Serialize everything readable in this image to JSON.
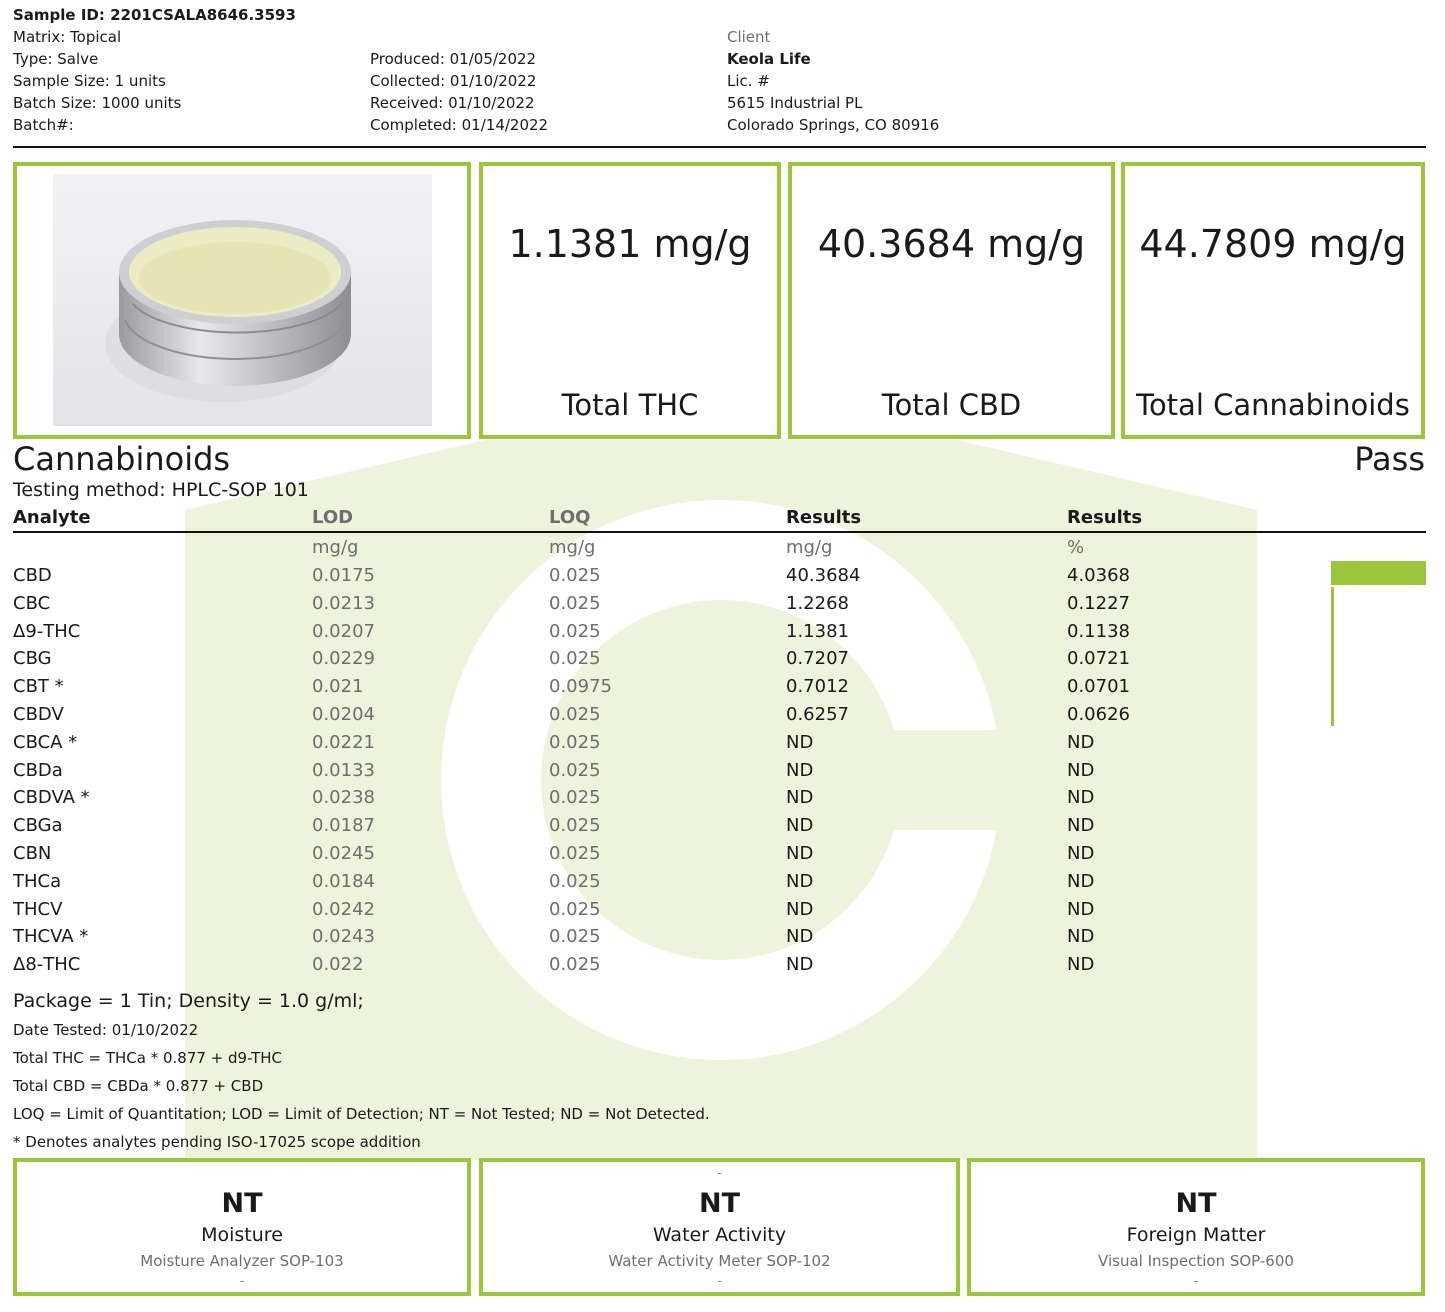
{
  "sample": {
    "id_line": "Sample ID: 2201CSALA8646.3593",
    "matrix": "Matrix: Topical",
    "type": "Type: Salve",
    "sample_size": "Sample Size: 1 units",
    "batch_size": "Batch Size: 1000 units",
    "batch_no": "Batch#:"
  },
  "dates": {
    "produced": "Produced: 01/05/2022",
    "collected": "Collected: 01/10/2022",
    "received": "Received: 01/10/2022",
    "completed": "Completed: 01/14/2022"
  },
  "client": {
    "heading": "Client",
    "name": "Keola Life",
    "lic": "Lic. #",
    "address1": "5615 Industrial PL",
    "address2": "Colorado Springs, CO 80916"
  },
  "summary": [
    {
      "value": "1.1381 mg/g",
      "label": "Total THC"
    },
    {
      "value": "40.3684 mg/g",
      "label": "Total CBD"
    },
    {
      "value": "44.7809 mg/g",
      "label": "Total Cannabinoids"
    }
  ],
  "cannabinoids": {
    "title": "Cannabinoids",
    "status": "Pass",
    "method": "Testing method: HPLC-SOP 101",
    "headers": [
      "Analyte",
      "LOD",
      "LOQ",
      "Results",
      "Results"
    ],
    "units": [
      "mg/g",
      "mg/g",
      "mg/g",
      "%"
    ],
    "rows": [
      {
        "analyte": "CBD",
        "lod": "0.0175",
        "loq": "0.025",
        "mg": "40.3684",
        "pct": "4.0368",
        "bar_pct": 4.0368
      },
      {
        "analyte": "CBC",
        "lod": "0.0213",
        "loq": "0.025",
        "mg": "1.2268",
        "pct": "0.1227",
        "bar_pct": 0.1227
      },
      {
        "analyte": "Δ9-THC",
        "lod": "0.0207",
        "loq": "0.025",
        "mg": "1.1381",
        "pct": "0.1138",
        "bar_pct": 0.1138
      },
      {
        "analyte": "CBG",
        "lod": "0.0229",
        "loq": "0.025",
        "mg": "0.7207",
        "pct": "0.0721",
        "bar_pct": 0.0721
      },
      {
        "analyte": "CBT *",
        "lod": "0.021",
        "loq": "0.0975",
        "mg": "0.7012",
        "pct": "0.0701",
        "bar_pct": 0.0701
      },
      {
        "analyte": "CBDV",
        "lod": "0.0204",
        "loq": "0.025",
        "mg": "0.6257",
        "pct": "0.0626",
        "bar_pct": 0.0626
      },
      {
        "analyte": "CBCA *",
        "lod": "0.0221",
        "loq": "0.025",
        "mg": "ND",
        "pct": "ND",
        "bar_pct": 0
      },
      {
        "analyte": "CBDa",
        "lod": "0.0133",
        "loq": "0.025",
        "mg": "ND",
        "pct": "ND",
        "bar_pct": 0
      },
      {
        "analyte": "CBDVA *",
        "lod": "0.0238",
        "loq": "0.025",
        "mg": "ND",
        "pct": "ND",
        "bar_pct": 0
      },
      {
        "analyte": "CBGa",
        "lod": "0.0187",
        "loq": "0.025",
        "mg": "ND",
        "pct": "ND",
        "bar_pct": 0
      },
      {
        "analyte": "CBN",
        "lod": "0.0245",
        "loq": "0.025",
        "mg": "ND",
        "pct": "ND",
        "bar_pct": 0
      },
      {
        "analyte": "THCa",
        "lod": "0.0184",
        "loq": "0.025",
        "mg": "ND",
        "pct": "ND",
        "bar_pct": 0
      },
      {
        "analyte": "THCV",
        "lod": "0.0242",
        "loq": "0.025",
        "mg": "ND",
        "pct": "ND",
        "bar_pct": 0
      },
      {
        "analyte": "THCVA *",
        "lod": "0.0243",
        "loq": "0.025",
        "mg": "ND",
        "pct": "ND",
        "bar_pct": 0
      },
      {
        "analyte": "Δ8-THC",
        "lod": "0.022",
        "loq": "0.025",
        "mg": "ND",
        "pct": "ND",
        "bar_pct": 0
      }
    ]
  },
  "notes": {
    "package": "Package = 1 Tin; Density = 1.0 g/ml;",
    "date_tested": "Date Tested: 01/10/2022",
    "total_thc": "Total THC = THCa * 0.877 + d9-THC",
    "total_cbd": "Total CBD = CBDa * 0.877 + CBD",
    "legend": "LOQ = Limit of Quantitation; LOD = Limit of Detection; NT = Not Tested; ND = Not Detected.",
    "pending": "* Denotes analytes pending ISO-17025 scope addition"
  },
  "safety": [
    {
      "value": "NT",
      "label": "Moisture",
      "method": "Moisture Analyzer SOP-103",
      "dash": "-"
    },
    {
      "value": "NT",
      "label": "Water Activity",
      "method": "Water Activity Meter SOP-102",
      "dash": "-",
      "top_dash": "-"
    },
    {
      "value": "NT",
      "label": "Foreign Matter",
      "method": "Visual Inspection SOP-600",
      "dash": "-"
    }
  ],
  "colors": {
    "accent": "#9bc53d",
    "watermark": "#eef4dc"
  }
}
